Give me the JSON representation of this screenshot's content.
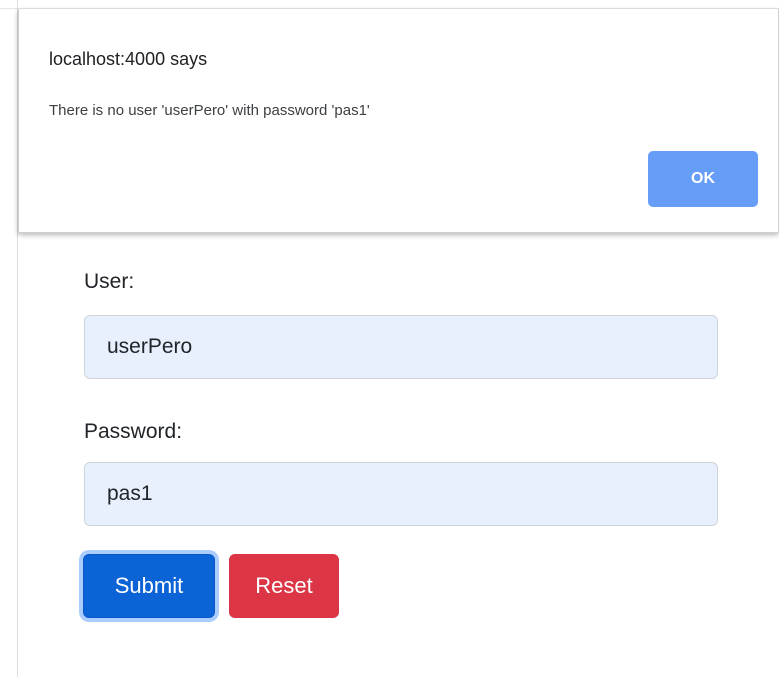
{
  "dialog": {
    "title": "localhost:4000 says",
    "message": "There is no user 'userPero' with password 'pas1'",
    "ok_label": "OK"
  },
  "form": {
    "user_label": "User:",
    "user_value": "userPero",
    "password_label": "Password:",
    "password_value": "pas1",
    "submit_label": "Submit",
    "reset_label": "Reset"
  },
  "colors": {
    "ok_button": "#669df6",
    "input_background": "#e8f0fe",
    "submit_button": "#0b63d6",
    "reset_button": "#dc3545"
  }
}
